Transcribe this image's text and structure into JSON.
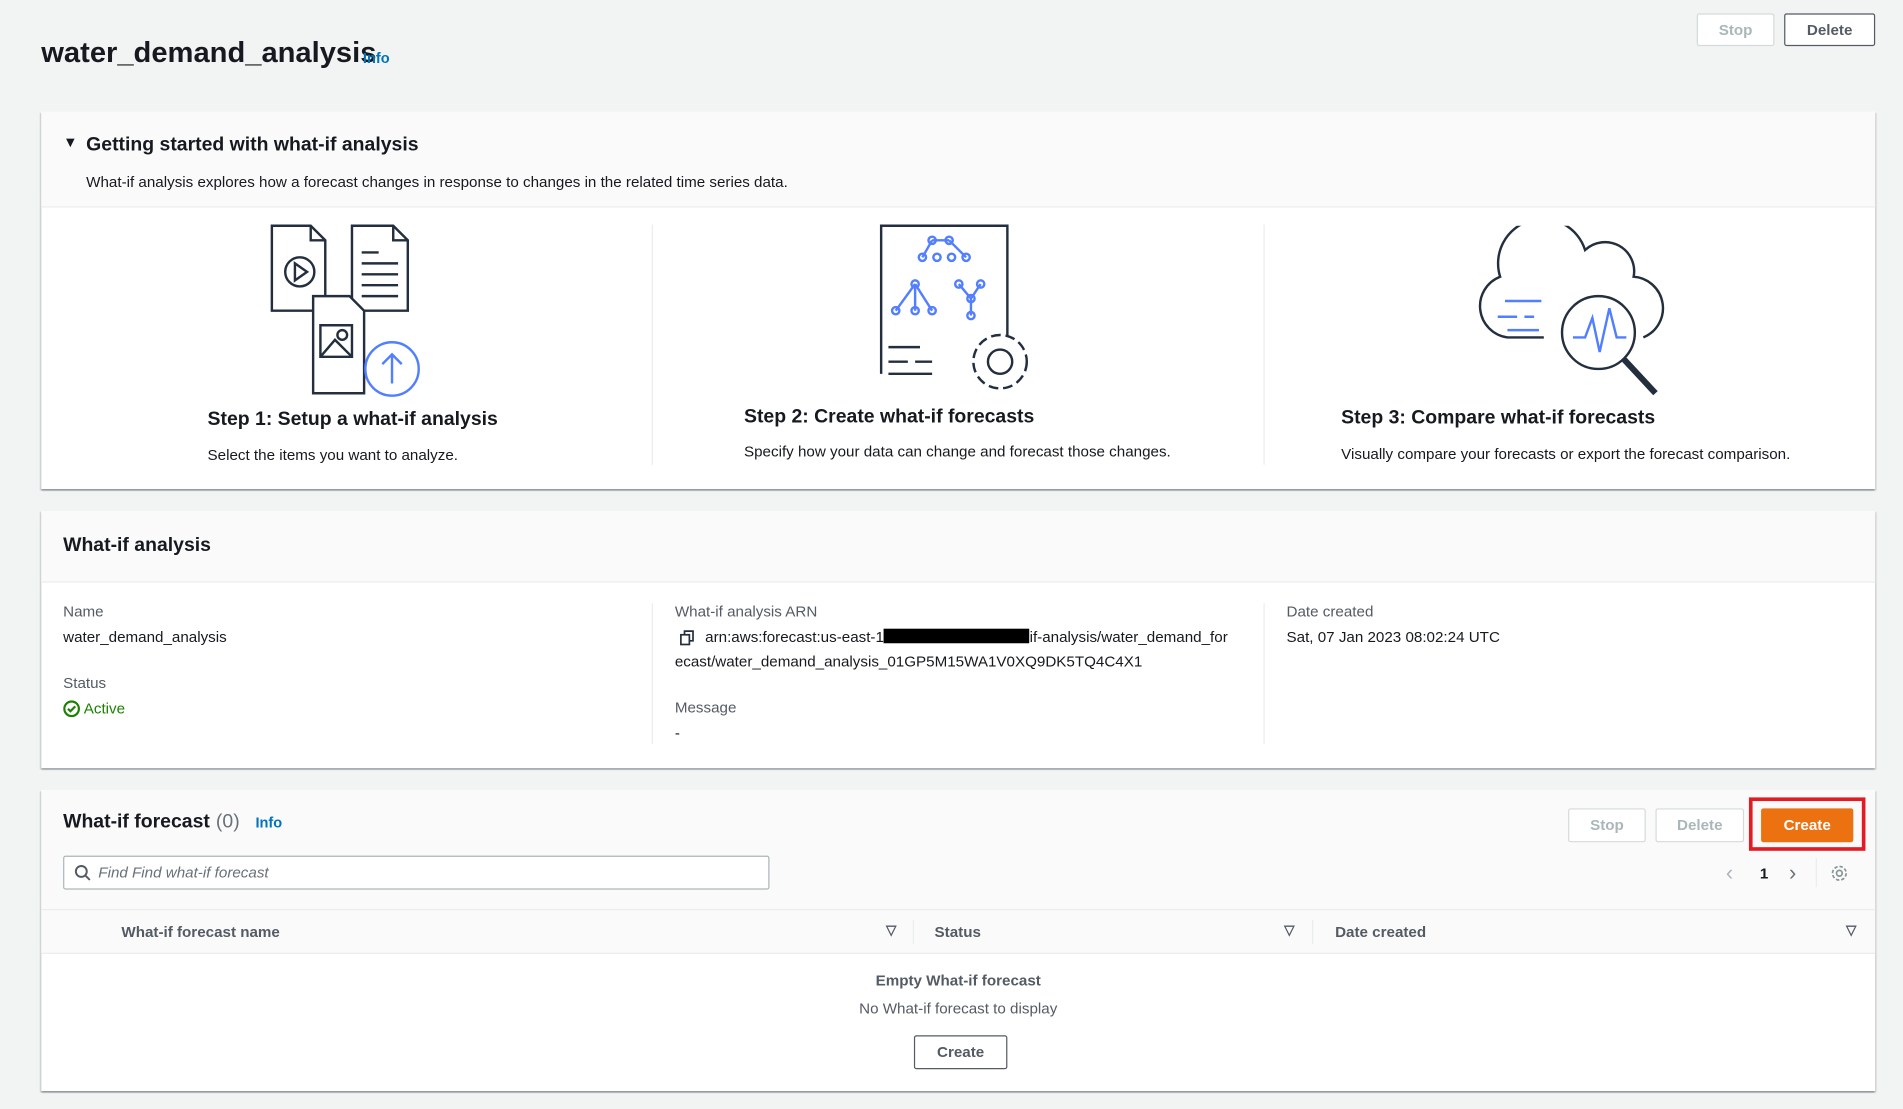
{
  "header": {
    "title": "water_demand_analysis",
    "info": "Info",
    "stop": "Stop",
    "delete": "Delete"
  },
  "getting_started": {
    "title": "Getting started with what-if analysis",
    "description": "What-if analysis explores how a forecast changes in response to changes in the related time series data.",
    "steps": [
      {
        "title": "Step 1: Setup a what-if analysis",
        "desc": "Select the items you want to analyze.",
        "icon": "upload-files-icon"
      },
      {
        "title": "Step 2: Create what-if forecasts",
        "desc": "Specify how your data can change and forecast those changes.",
        "icon": "settings-diagram-icon"
      },
      {
        "title": "Step 3: Compare what-if forecasts",
        "desc": "Visually compare your forecasts or export the forecast comparison.",
        "icon": "cloud-magnifier-icon"
      }
    ]
  },
  "analysis": {
    "title": "What-if analysis",
    "name_label": "Name",
    "name": "water_demand_analysis",
    "status_label": "Status",
    "status": "Active",
    "arn_label": "What-if analysis ARN",
    "arn_prefix": "arn:aws:forecast:us-east-1",
    "arn_suffix": "if-analysis/water_demand_for",
    "arn_line2": "ecast/water_demand_analysis_01GP5M15WA1V0XQ9DK5TQ4C4X1",
    "message_label": "Message",
    "message": "-",
    "date_label": "Date created",
    "date": "Sat, 07 Jan 2023 08:02:24 UTC"
  },
  "forecast": {
    "title": "What-if forecast",
    "count": "(0)",
    "info": "Info",
    "stop": "Stop",
    "delete": "Delete",
    "create": "Create",
    "search_placeholder": "Find Find what-if forecast",
    "page": "1",
    "columns": [
      "What-if forecast name",
      "Status",
      "Date created"
    ],
    "empty_title": "Empty What-if forecast",
    "empty_desc": "No What-if forecast to display",
    "empty_create": "Create"
  },
  "colors": {
    "accent": "#ec7211",
    "link": "#0073bb",
    "success": "#1d8102",
    "highlight": "#e41b23"
  }
}
